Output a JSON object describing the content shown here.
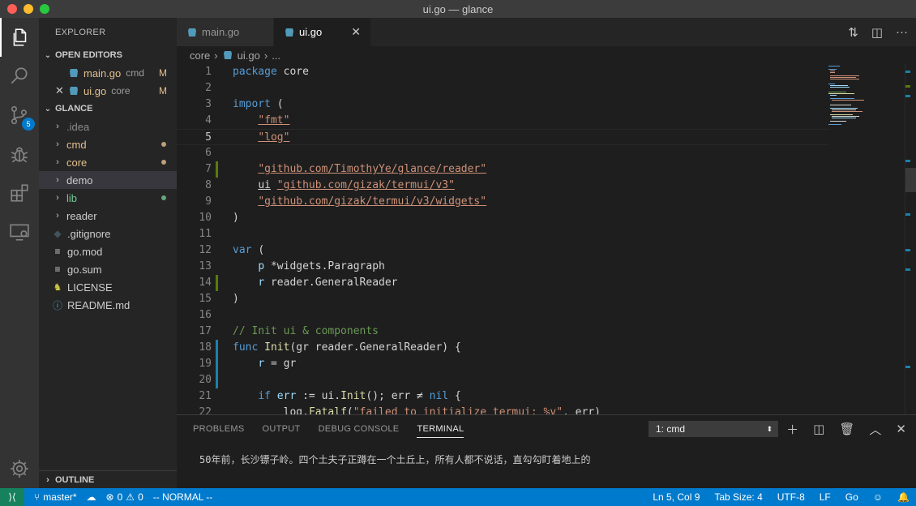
{
  "window": {
    "title": "ui.go — glance"
  },
  "activity_bar": {
    "items": [
      {
        "icon": "files-icon"
      },
      {
        "icon": "search-icon"
      },
      {
        "icon": "source-control-icon",
        "badge": "5"
      },
      {
        "icon": "debug-icon"
      },
      {
        "icon": "extensions-icon"
      },
      {
        "icon": "remote-explorer-icon"
      }
    ],
    "bottom_icon": "gear-icon"
  },
  "sidebar": {
    "title": "EXPLORER",
    "open_editors_label": "OPEN EDITORS",
    "open_editors": [
      {
        "name": "main.go",
        "desc": "cmd",
        "git": "M"
      },
      {
        "name": "ui.go",
        "desc": "core",
        "git": "M"
      }
    ],
    "project_label": "GLANCE",
    "tree": [
      {
        "name": ".idea",
        "type": "folder",
        "color": "#8c8c8c"
      },
      {
        "name": "cmd",
        "type": "folder",
        "color": "#e2c08d",
        "dot": "#e2c08d"
      },
      {
        "name": "core",
        "type": "folder",
        "color": "#e2c08d",
        "dot": "#e2c08d"
      },
      {
        "name": "demo",
        "type": "folder",
        "color": "#cccccc"
      },
      {
        "name": "lib",
        "type": "folder",
        "color": "#73c991",
        "dot": "#73c991"
      },
      {
        "name": "reader",
        "type": "folder",
        "color": "#cccccc"
      },
      {
        "name": ".gitignore",
        "type": "file",
        "color": "#cccccc"
      },
      {
        "name": "go.mod",
        "type": "file",
        "color": "#cccccc"
      },
      {
        "name": "go.sum",
        "type": "file",
        "color": "#cccccc"
      },
      {
        "name": "LICENSE",
        "type": "file",
        "color": "#cccccc"
      },
      {
        "name": "README.md",
        "type": "file",
        "color": "#cccccc"
      }
    ],
    "outline_label": "OUTLINE"
  },
  "tabs": [
    {
      "label": "main.go",
      "active": false
    },
    {
      "label": "ui.go",
      "active": true
    }
  ],
  "breadcrumb": {
    "folder": "core",
    "file": "ui.go",
    "more": "..."
  },
  "code_lines": [
    {
      "n": "1",
      "html": "<span class='kw'>package</span> <span class='pl'>core</span>"
    },
    {
      "n": "2",
      "html": ""
    },
    {
      "n": "3",
      "html": "<span class='kw'>import</span> <span class='pl'>(</span>"
    },
    {
      "n": "4",
      "html": "    <span class='str'>\"fmt\"</span>"
    },
    {
      "n": "5",
      "html": "    <span class='str'>\"log\"</span>"
    },
    {
      "n": "6",
      "html": ""
    },
    {
      "n": "7",
      "html": "    <span class='str'>\"github.com/TimothyYe/glance/reader\"</span>"
    },
    {
      "n": "8",
      "html": "    <span class='pl' style='text-decoration:underline'>ui</span> <span class='str'>\"github.com/gizak/termui/v3\"</span>"
    },
    {
      "n": "9",
      "html": "    <span class='str'>\"github.com/gizak/termui/v3/widgets\"</span>"
    },
    {
      "n": "10",
      "html": "<span class='pl'>)</span>"
    },
    {
      "n": "11",
      "html": ""
    },
    {
      "n": "12",
      "html": "<span class='kw'>var</span> <span class='pl'>(</span>"
    },
    {
      "n": "13",
      "html": "    <span class='vr'>p</span> <span class='pl'>*widgets.Paragraph</span>"
    },
    {
      "n": "14",
      "html": "    <span class='vr'>r</span> <span class='pl'>reader.GeneralReader</span>"
    },
    {
      "n": "15",
      "html": "<span class='pl'>)</span>"
    },
    {
      "n": "16",
      "html": ""
    },
    {
      "n": "17",
      "html": "<span class='cm'>// Init ui &amp; components</span>"
    },
    {
      "n": "18",
      "html": "<span class='kw'>func</span> <span class='fn'>Init</span><span class='pl'>(gr reader.GeneralReader) {</span>"
    },
    {
      "n": "19",
      "html": "    <span class='vr'>r</span> <span class='pl'>= gr</span>"
    },
    {
      "n": "20",
      "html": ""
    },
    {
      "n": "21",
      "html": "    <span class='kw'>if</span> <span class='vr'>err</span> <span class='pl'>:= ui.</span><span class='fn'>Init</span><span class='pl'>(); err ≠ </span><span class='kw'>nil</span> <span class='pl'>{</span>"
    },
    {
      "n": "22",
      "html": "        <span class='pl'>log.</span><span class='fn'>Fatalf</span><span class='pl'>(</span><span class='str'>\"failed to initialize termui: %v\"</span><span class='pl'>, err)</span>"
    }
  ],
  "panel": {
    "tabs": [
      "PROBLEMS",
      "OUTPUT",
      "DEBUG CONSOLE",
      "TERMINAL"
    ],
    "active_tab": "TERMINAL",
    "terminal_selector": "1: cmd",
    "terminal_text": "50年前，长沙镖子岭。四个土夫子正蹲在一个土丘上，所有人都不说话，直勾勾盯着地上的"
  },
  "status_bar": {
    "branch": "master*",
    "errors": "0",
    "warnings": "0",
    "mode": "-- NORMAL --",
    "position": "Ln 5, Col 9",
    "tab_size": "Tab Size: 4",
    "encoding": "UTF-8",
    "eol": "LF",
    "language": "Go"
  }
}
